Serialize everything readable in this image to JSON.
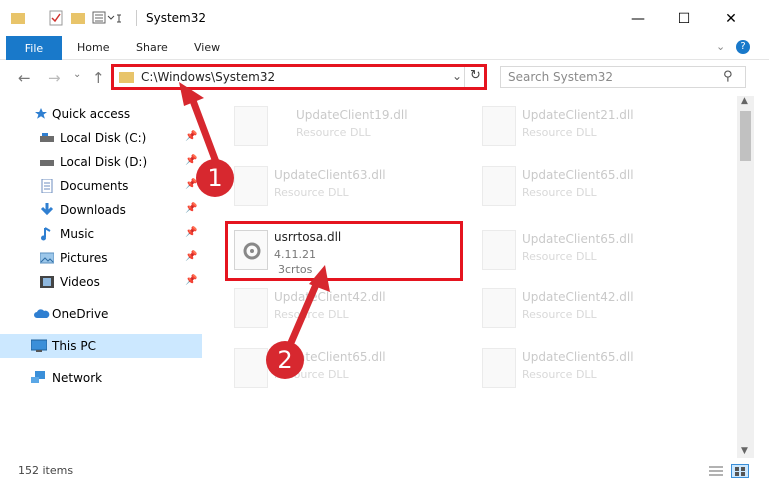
{
  "window": {
    "title": "System32"
  },
  "ribbon": {
    "file_tab": "File",
    "tabs": [
      "Home",
      "Share",
      "View"
    ]
  },
  "address": {
    "path": "C:\\Windows\\System32"
  },
  "search": {
    "placeholder": "Search System32"
  },
  "sidebar": {
    "items": [
      {
        "label": "Quick access",
        "icon": "star-icon",
        "pinned": false
      },
      {
        "label": "Local Disk (C:)",
        "icon": "drive-icon",
        "pinned": true
      },
      {
        "label": "Local Disk (D:)",
        "icon": "drive-icon",
        "pinned": true
      },
      {
        "label": "Documents",
        "icon": "documents-icon",
        "pinned": true
      },
      {
        "label": "Downloads",
        "icon": "download-icon",
        "pinned": true
      },
      {
        "label": "Music",
        "icon": "music-icon",
        "pinned": true
      },
      {
        "label": "Pictures",
        "icon": "pictures-icon",
        "pinned": true
      },
      {
        "label": "Videos",
        "icon": "videos-icon",
        "pinned": true
      },
      {
        "label": "OneDrive",
        "icon": "cloud-icon",
        "pinned": false
      },
      {
        "label": "This PC",
        "icon": "computer-icon",
        "pinned": false,
        "selected": true
      },
      {
        "label": "Network",
        "icon": "network-icon",
        "pinned": false
      }
    ]
  },
  "files": [
    {
      "name": "UpdateClient19.dll",
      "type": "Resource DLL"
    },
    {
      "name": "UpdateClient21.dll",
      "type": "Resource DLL"
    },
    {
      "name": "UpdateClient63.dll",
      "type": "Resource DLL"
    },
    {
      "name": "UpdateClient65.dll",
      "type": "Resource DLL"
    },
    {
      "name": "usrrtosa.dll",
      "version": "4.11.21",
      "company": "3crtos"
    },
    {
      "name": "UpdateClient65.dll",
      "type": "Resource DLL"
    },
    {
      "name": "UpdateClient42.dll",
      "type": "Resource DLL"
    },
    {
      "name": "UpdateClient42.dll",
      "type": "Resource DLL"
    },
    {
      "name": "UpdateClient65.dll",
      "type": "Resource DLL"
    },
    {
      "name": "UpdateClient65.dll",
      "type": "Resource DLL"
    }
  ],
  "callouts": {
    "step1": "1",
    "step2": "2"
  },
  "status": {
    "items": "152 items"
  },
  "colors": {
    "accent": "#1979ca",
    "highlight": "#e5141f",
    "badge": "#d7282f"
  }
}
